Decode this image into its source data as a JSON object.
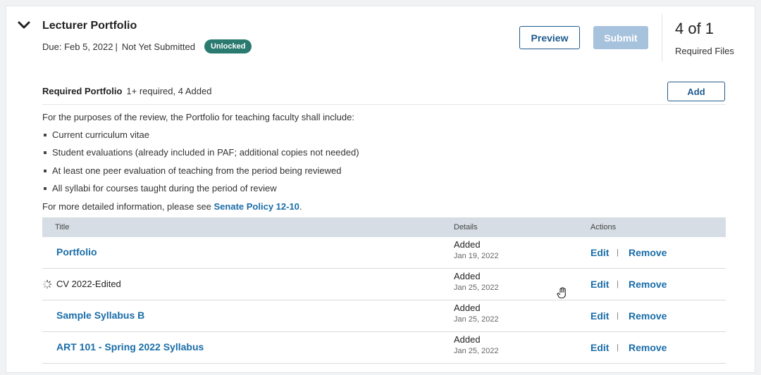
{
  "section": {
    "title": "Lecturer Portfolio",
    "due": "Due: Feb 5, 2022",
    "separator": "|",
    "status": "Not Yet Submitted",
    "badge": "Unlocked",
    "preview_label": "Preview",
    "submit_label": "Submit",
    "count": "4 of 1",
    "count_label": "Required Files"
  },
  "requirement": {
    "heading": "Required Portfolio",
    "info": "1+ required, 4 Added",
    "add_label": "Add"
  },
  "instructions": {
    "intro": "For the purposes of the review, the Portfolio for teaching faculty shall include:",
    "bullets": [
      "Current curriculum vitae",
      "Student evaluations (already included in PAF; additional copies not needed)",
      "At least one peer evaluation of teaching from the period being reviewed",
      "All syllabi for courses taught during the period of review"
    ],
    "more_prefix": "For more detailed information, please see ",
    "more_link": "Senate Policy 12-10",
    "more_suffix": "."
  },
  "table": {
    "headers": [
      "Title",
      "Details",
      "Actions"
    ],
    "rows": [
      {
        "title": "Portfolio",
        "status": "Added",
        "date": "Jan 19, 2022",
        "edit": "Edit",
        "pipe": "|",
        "remove": "Remove"
      },
      {
        "title": "CV 2022-Edited",
        "status": "Added",
        "date": "Jan 25, 2022",
        "edit": "Edit",
        "pipe": "|",
        "remove": "Remove"
      },
      {
        "title": "Sample Syllabus B",
        "status": "Added",
        "date": "Jan 25, 2022",
        "edit": "Edit",
        "pipe": "|",
        "remove": "Remove"
      },
      {
        "title": "ART 101 - Spring 2022 Syllabus",
        "status": "Added",
        "date": "Jan 25, 2022",
        "edit": "Edit",
        "pipe": "|",
        "remove": "Remove"
      }
    ]
  },
  "icons": {
    "collapse": "chevron-down-icon",
    "loading": "loading-spinner-icon",
    "cursor": "hand-cursor-icon"
  },
  "colors": {
    "accent": "#1a6da8",
    "badge": "#2a7a6f",
    "submit_disabled": "#a7c2dd",
    "table_header": "#d6dde4"
  }
}
